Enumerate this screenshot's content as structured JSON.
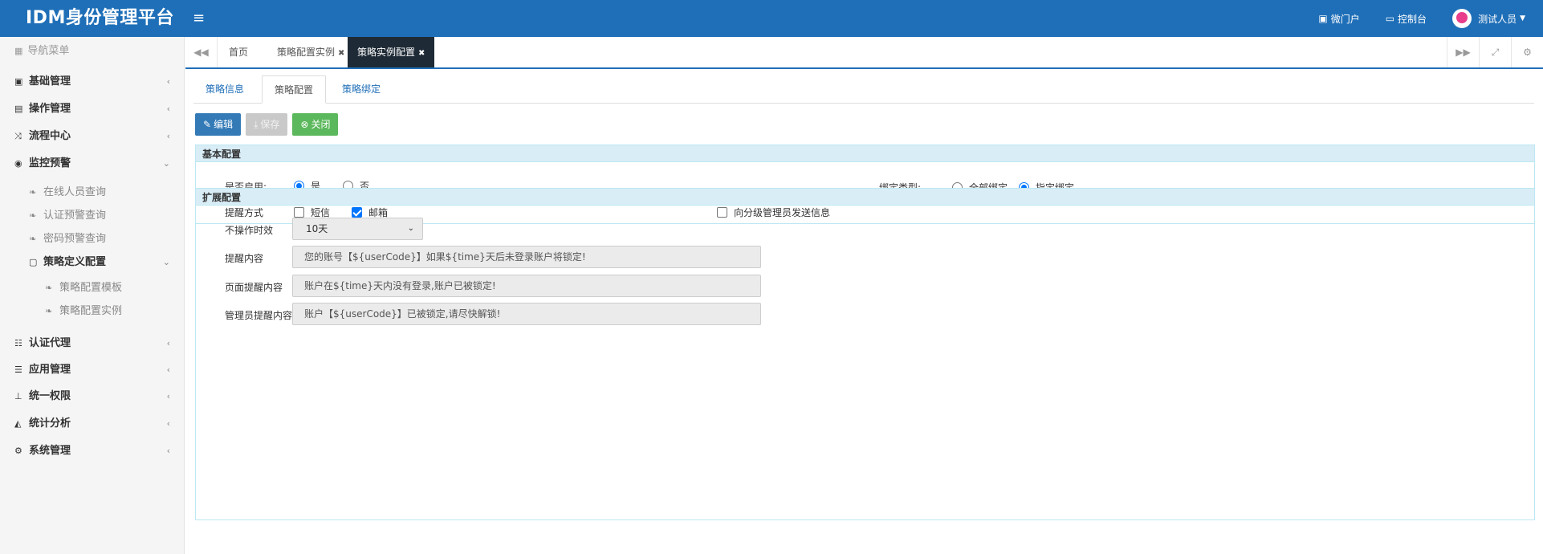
{
  "header": {
    "brand": "IDM身份管理平台",
    "menu_icon": "hamburger-icon",
    "portal_label": "微门户",
    "console_label": "控制台",
    "user_name": "测试人员"
  },
  "sidebar": {
    "title": "导航菜单",
    "items": [
      {
        "label": "基础管理",
        "icon": "id-card-icon"
      },
      {
        "label": "操作管理",
        "icon": "book-icon"
      },
      {
        "label": "流程中心",
        "icon": "shuffle-icon"
      },
      {
        "label": "监控预警",
        "icon": "eye-icon"
      },
      {
        "label": "在线人员查询",
        "icon": "leaf-icon"
      },
      {
        "label": "认证预警查询",
        "icon": "leaf-icon"
      },
      {
        "label": "密码预警查询",
        "icon": "leaf-icon"
      },
      {
        "label": "策略定义配置",
        "icon": "folder-icon"
      },
      {
        "label": "策略配置模板",
        "icon": "leaf-icon"
      },
      {
        "label": "策略配置实例",
        "icon": "leaf-icon"
      },
      {
        "label": "认证代理",
        "icon": "users-icon"
      },
      {
        "label": "应用管理",
        "icon": "list-icon"
      },
      {
        "label": "统一权限",
        "icon": "sitemap-icon"
      },
      {
        "label": "统计分析",
        "icon": "area-chart-icon"
      },
      {
        "label": "系统管理",
        "icon": "gears-icon"
      }
    ]
  },
  "tabs": [
    {
      "label": "首页"
    },
    {
      "label": "策略配置实例"
    },
    {
      "label": "策略实例配置"
    }
  ],
  "subtabs": [
    {
      "label": "策略信息"
    },
    {
      "label": "策略配置"
    },
    {
      "label": "策略绑定"
    }
  ],
  "buttons": {
    "edit": "编辑",
    "save": "保存",
    "close": "关闭"
  },
  "basic": {
    "title": "基本配置",
    "enable_label": "是否启用:",
    "enable_yes": "是",
    "enable_no": "否",
    "bind_label": "绑定类型:",
    "bind_all": "全部绑定",
    "bind_specific": "指定绑定",
    "remind_label": "提醒方式",
    "remind_sms": "短信",
    "remind_email": "邮箱",
    "notify_admin": "向分级管理员发送信息"
  },
  "extended": {
    "title": "扩展配置",
    "timeout_label": "不操作时效",
    "timeout_value": "10天",
    "remind_content_label": "提醒内容",
    "remind_content_value": "您的账号【${userCode}】如果${time}天后未登录账户将锁定!",
    "page_remind_label": "页面提醒内容",
    "page_remind_value": "账户在${time}天内没有登录,账户已被锁定!",
    "admin_remind_label": "管理员提醒内容",
    "admin_remind_value": "账户【${userCode}】已被锁定,请尽快解锁!"
  }
}
